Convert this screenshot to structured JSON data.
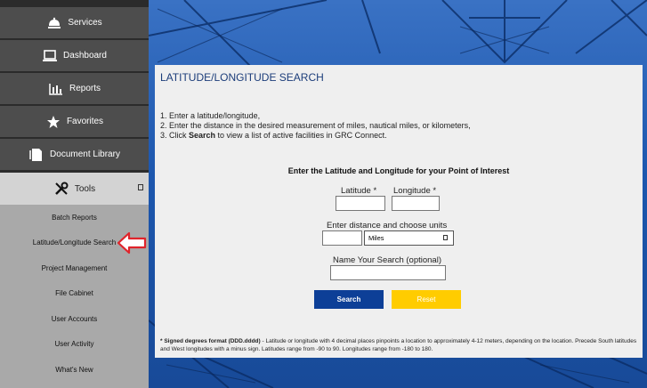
{
  "sidebar": {
    "items": [
      {
        "label": "Services",
        "icon": "bell-icon"
      },
      {
        "label": "Dashboard",
        "icon": "laptop-icon"
      },
      {
        "label": "Reports",
        "icon": "bar-chart-icon"
      },
      {
        "label": "Favorites",
        "icon": "star-icon"
      },
      {
        "label": "Document Library",
        "icon": "document-icon"
      },
      {
        "label": "Tools",
        "icon": "tools-icon"
      }
    ],
    "tools_submenu": [
      "Batch Reports",
      "Latitude/Longitude Search",
      "Project Management",
      "File Cabinet",
      "User Accounts",
      "User Activity",
      "What's New"
    ]
  },
  "panel": {
    "title": "LATITUDE/LONGITUDE SEARCH",
    "instructions": {
      "line1": "1. Enter a latitude/longitude,",
      "line2": "2. Enter the distance in the desired measurement of miles, nautical miles, or kilometers,",
      "line3_prefix": "3. Click ",
      "line3_bold": "Search",
      "line3_suffix": " to view a list of active facilities in GRC Connect."
    },
    "form_heading": "Enter the Latitude and Longitude for your Point of Interest",
    "latitude_label": "Latitude *",
    "longitude_label": "Longitude *",
    "distance_label": "Enter distance and choose units",
    "units_selected": "Miles",
    "search_name_label": "Name Your Search (optional)",
    "search_button": "Search",
    "reset_button": "Reset",
    "note_bold": "* Signed degrees format (DDD.dddd)",
    "note_text": " - Latitude or longitude with 4 decimal places pinpoints a location to approximately 4-12 meters, depending on the location. Precede South latitudes and West longitudes with a minus sign. Latitudes range from -90 to 90. Longitudes range from -180 to 180."
  },
  "colors": {
    "sidebar_item_bg": "#4d4d4d",
    "submenu_bg": "#a9a9a9",
    "search_button": "#0d3f97",
    "reset_button": "#ffcc00",
    "pointer_arrow": "#e0242b"
  }
}
